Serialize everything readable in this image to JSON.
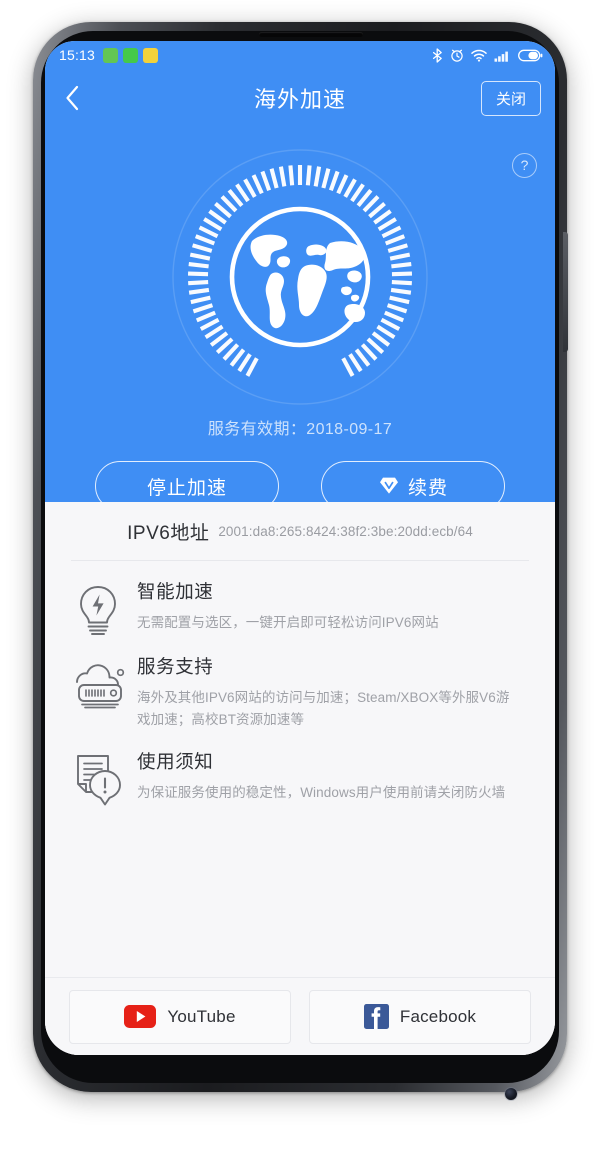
{
  "status_bar": {
    "time": "15:13",
    "notification_icons": [
      "app-icon-green",
      "wechat-icon",
      "weibo-icon"
    ],
    "system_icons": [
      "bluetooth-icon",
      "alarm-icon",
      "wifi-icon",
      "signal-icon",
      "battery-icon"
    ]
  },
  "appbar": {
    "back_label": "",
    "title": "海外加速",
    "close_label": "关闭"
  },
  "hero": {
    "help_label": "?",
    "globe_icon": "globe-icon",
    "validity": "服务有效期：2018-09-17",
    "buttons": [
      {
        "label": "停止加速",
        "icon": ""
      },
      {
        "label": "续费",
        "icon": "vip-diamond-icon"
      }
    ]
  },
  "ipv6": {
    "label": "IPV6地址",
    "value": "2001:da8:265:8424:38f2:3be:20dd:ecb/64"
  },
  "features": [
    {
      "icon": "lightbulb-icon",
      "title": "智能加速",
      "desc": "无需配置与选区，一键开启即可轻松访问IPV6网站"
    },
    {
      "icon": "cloud-server-icon",
      "title": "服务支持",
      "desc": "海外及其他IPV6网站的访问与加速；Steam/XBOX等外服V6游戏加速；高校BT资源加速等"
    },
    {
      "icon": "document-alert-icon",
      "title": "使用须知",
      "desc": "为保证服务使用的稳定性，Windows用户使用前请关闭防火墙"
    }
  ],
  "social": [
    {
      "label": "YouTube",
      "icon": "youtube-icon",
      "color": "#e62117"
    },
    {
      "label": "Facebook",
      "icon": "facebook-icon",
      "color": "#3b5998"
    }
  ],
  "colors": {
    "brand_blue": "#3f8ef4",
    "page_bg": "#f7f7f9",
    "title_text": "#2f3136",
    "muted_text": "#9fa1a7"
  }
}
